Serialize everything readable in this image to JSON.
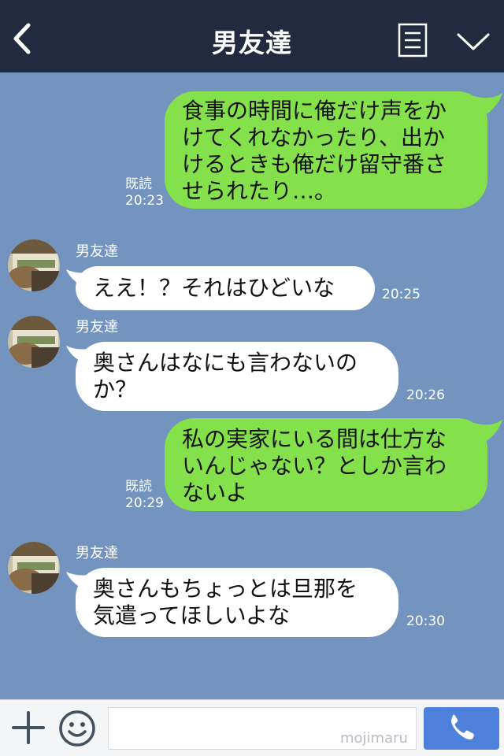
{
  "header": {
    "title": "男友達",
    "back_icon": "chevron-left-icon",
    "menu_icon": "list-icon",
    "collapse_icon": "chevron-down-icon"
  },
  "messages": [
    {
      "side": "out",
      "lines": [
        "食事の時間に俺だけ声をか",
        "けてくれなかったり、出か",
        "けるときも俺だけ留守番さ",
        "せられたり…。"
      ],
      "read": "既読",
      "time": "20:23"
    },
    {
      "side": "in",
      "sender": "男友達",
      "lines": [
        "ええ！？それはひどいな"
      ],
      "time": "20:25"
    },
    {
      "side": "in",
      "sender": "男友達",
      "lines": [
        "奥さんはなにも言わないの",
        "か？"
      ],
      "time": "20:26"
    },
    {
      "side": "out",
      "lines": [
        "私の実家にいる間は仕方な",
        "いんじゃない？としか言わ",
        "ないよ"
      ],
      "read": "既読",
      "time": "20:29"
    },
    {
      "side": "in",
      "sender": "男友達",
      "lines": [
        "奥さんもちょっとは旦那を",
        "気遣ってほしいよな"
      ],
      "time": "20:30"
    }
  ],
  "input_bar": {
    "plus_icon": "plus-icon",
    "emoji_icon": "smiley-icon",
    "input_value": "",
    "watermark": "mojimaru",
    "call_icon": "phone-icon"
  },
  "colors": {
    "header_bg": "#222a40",
    "chat_bg": "#7494c0",
    "outgoing_bubble": "#84e14c",
    "incoming_bubble": "#ffffff",
    "call_button": "#4e81dc"
  }
}
